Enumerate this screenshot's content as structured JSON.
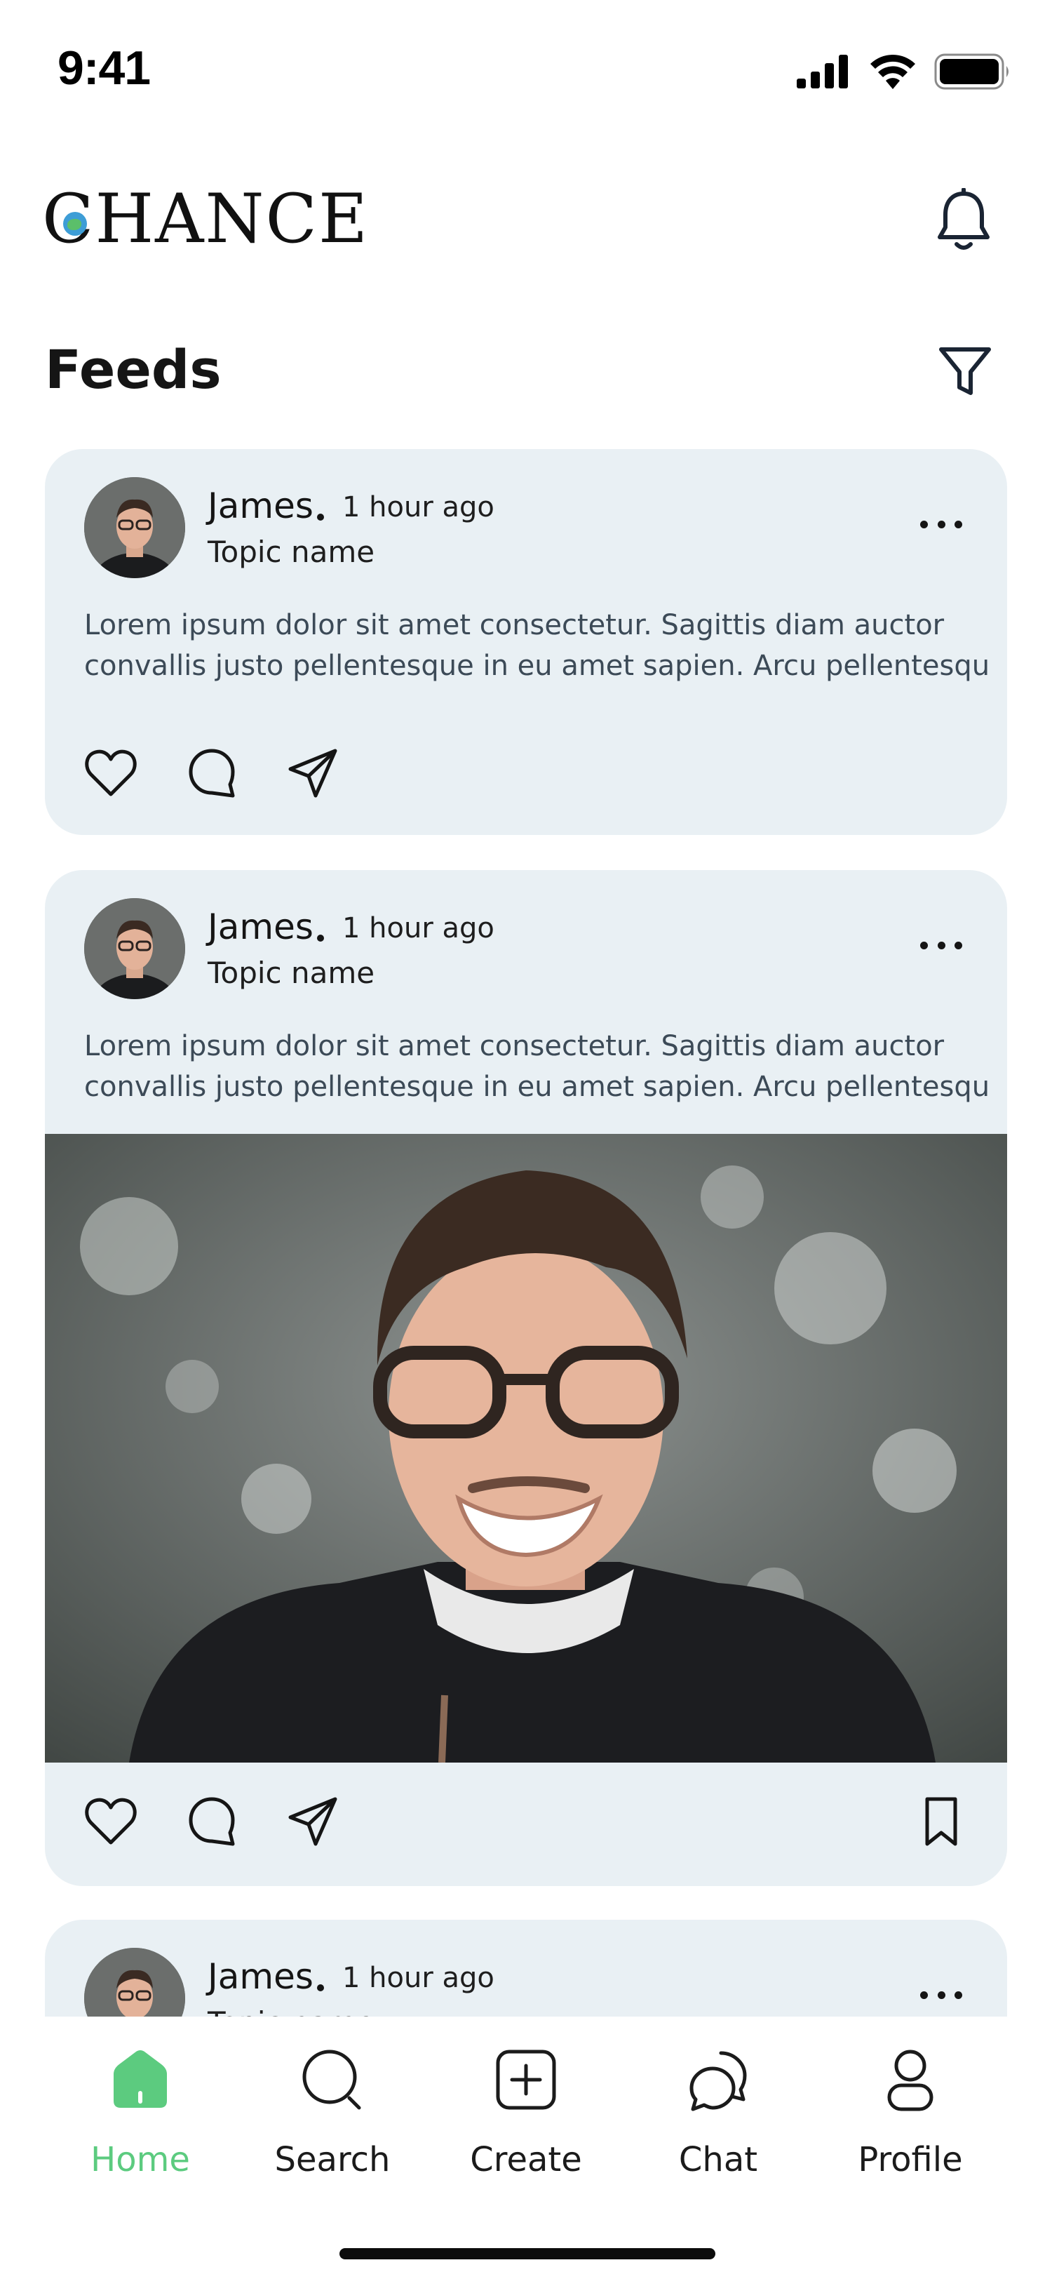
{
  "status_bar": {
    "time": "9:41"
  },
  "header": {
    "logo_text": "CHANCE"
  },
  "feed": {
    "title": "Feeds"
  },
  "posts": [
    {
      "author": "James",
      "time": "1 hour ago",
      "topic": "Topic name",
      "text_line1": "Lorem ipsum dolor sit amet consectetur. Sagittis diam auctor",
      "text_line2": "convallis justo pellentesque in eu amet sapien. Arcu pellentesque...."
    },
    {
      "author": "James",
      "time": "1 hour ago",
      "topic": "Topic name",
      "text_line1": "Lorem ipsum dolor sit amet consectetur. Sagittis diam auctor",
      "text_line2": "convallis justo pellentesque in eu amet sapien. Arcu pellentesque."
    },
    {
      "author": "James",
      "time": "1 hour ago",
      "topic": "Topic name"
    }
  ],
  "nav": {
    "items": [
      {
        "label": "Home",
        "icon": "home-icon",
        "active": true
      },
      {
        "label": "Search",
        "icon": "search-icon"
      },
      {
        "label": "Create",
        "icon": "plus-square-icon"
      },
      {
        "label": "Chat",
        "icon": "chat-icon"
      },
      {
        "label": "Profile",
        "icon": "user-icon"
      }
    ]
  },
  "colors": {
    "accent": "#5ccb7f",
    "card_background": "#e9f0f4",
    "body_text": "#3c4a57"
  }
}
